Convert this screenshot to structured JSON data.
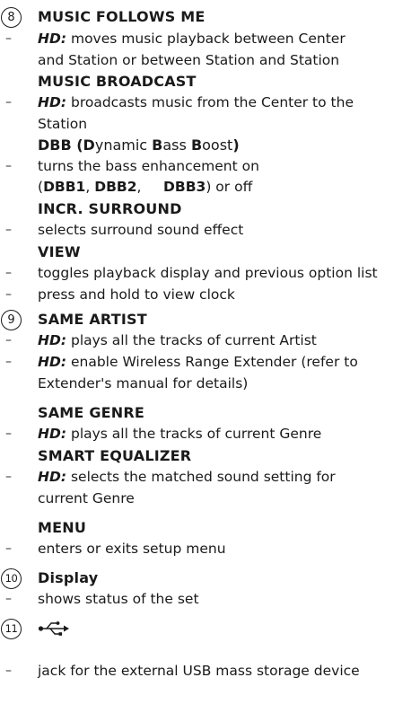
{
  "sections": {
    "s8": {
      "number": "8",
      "music_follows": {
        "title": "MUSIC FOLLOWS ME",
        "hd": "HD:",
        "desc1": " moves music playback between Center",
        "desc2": "and Station or between Station and Station"
      },
      "music_broadcast": {
        "title": "MUSIC BROADCAST",
        "hd": "HD:",
        "desc1": " broadcasts music from the Center to the",
        "desc2": "Station"
      },
      "dbb": {
        "t1": "DBB (D",
        "t2": "ynamic ",
        "t3": "B",
        "t4": "ass ",
        "t5": "B",
        "t6": "oost",
        "t7": ")",
        "desc1": "turns the bass enhancement on",
        "desc2a": "(",
        "desc2b": "DBB1",
        "desc2c": ", ",
        "desc2d": "DBB2",
        "desc2e": ",     ",
        "desc2f": "DBB3",
        "desc2g": ") or off"
      },
      "incr": {
        "title": "INCR. SURROUND",
        "desc": "selects surround sound effect"
      },
      "view": {
        "title": "VIEW",
        "desc1": "toggles playback display and previous option list",
        "desc2": "press and hold to view clock"
      }
    },
    "s9": {
      "number": "9",
      "same_artist": {
        "title": "SAME ARTIST",
        "hd": "HD:",
        "desc1": " plays all the tracks of current Artist",
        "desc2a": " enable Wireless Range Extender (refer to",
        "desc2b": "Extender's manual for details)"
      },
      "same_genre": {
        "title": "SAME GENRE",
        "hd": "HD:",
        "desc": " plays all the tracks of current Genre"
      },
      "smart_eq": {
        "title": "SMART EQUALIZER",
        "hd": "HD:",
        "desc1": " selects the matched sound setting for",
        "desc2": "current Genre"
      },
      "menu": {
        "title": "MENU",
        "desc": "enters or exits setup menu"
      }
    },
    "s10": {
      "number": "10",
      "title": "Display",
      "desc": "shows status of the set"
    },
    "s11": {
      "number": "11",
      "icon": "usb-icon",
      "desc": "jack for the external USB mass storage device"
    }
  },
  "dash": "–"
}
